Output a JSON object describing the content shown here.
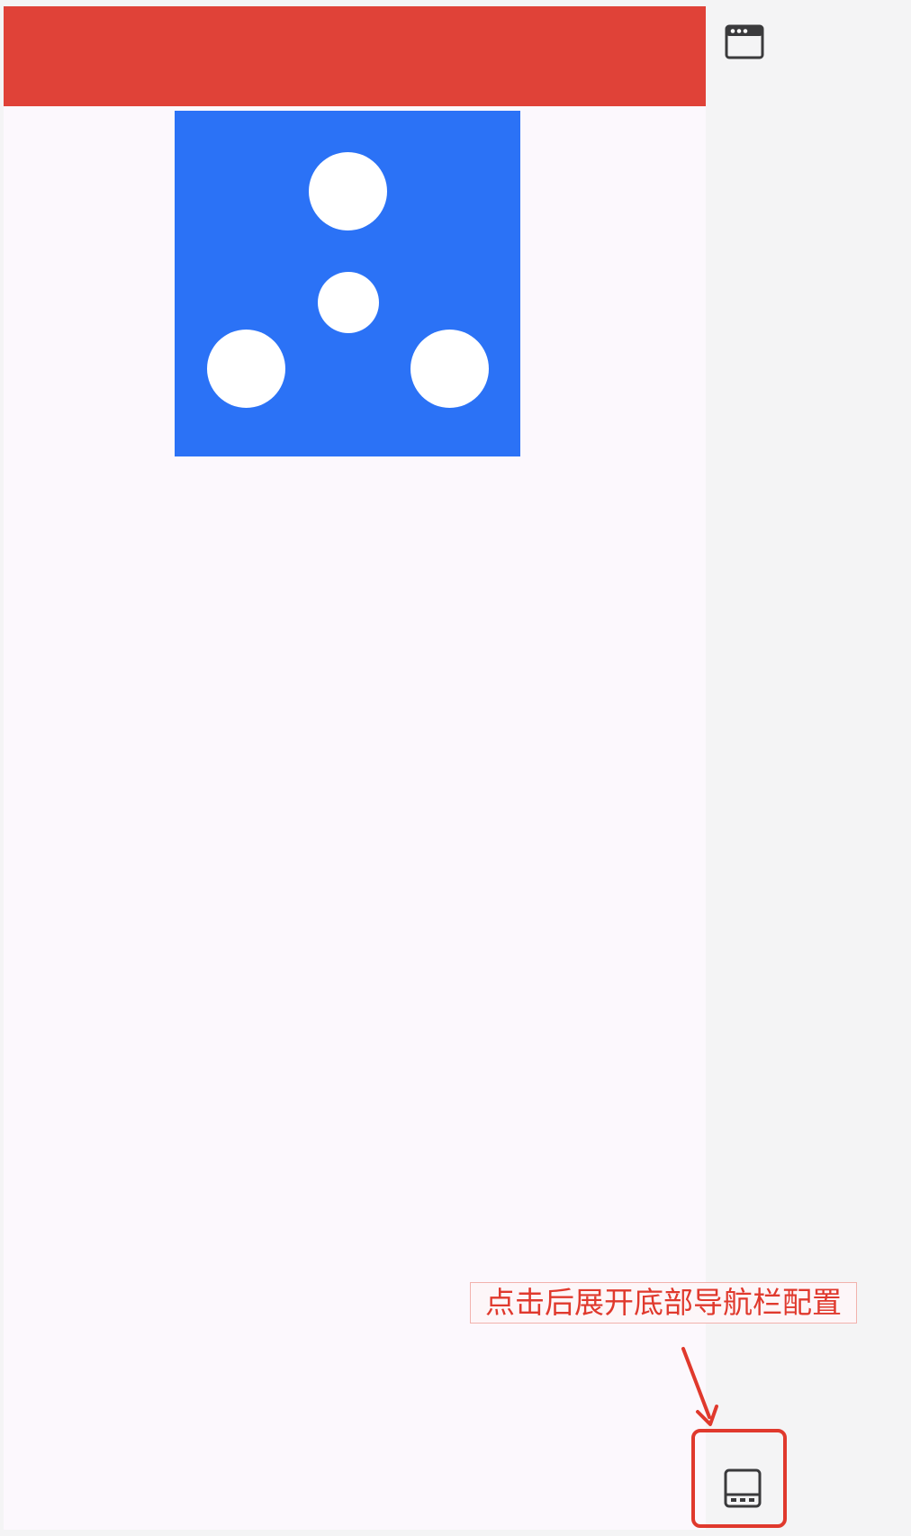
{
  "preview": {
    "header_color": "#e04238",
    "logo_color": "#2b72f6",
    "background_color": "#fcf8fd"
  },
  "toolbar": {
    "top_icon": "browser-window-icon",
    "bottom_icon": "bottom-nav-icon"
  },
  "annotation": {
    "label": "点击后展开底部导航栏配置",
    "color": "#e0392d"
  }
}
